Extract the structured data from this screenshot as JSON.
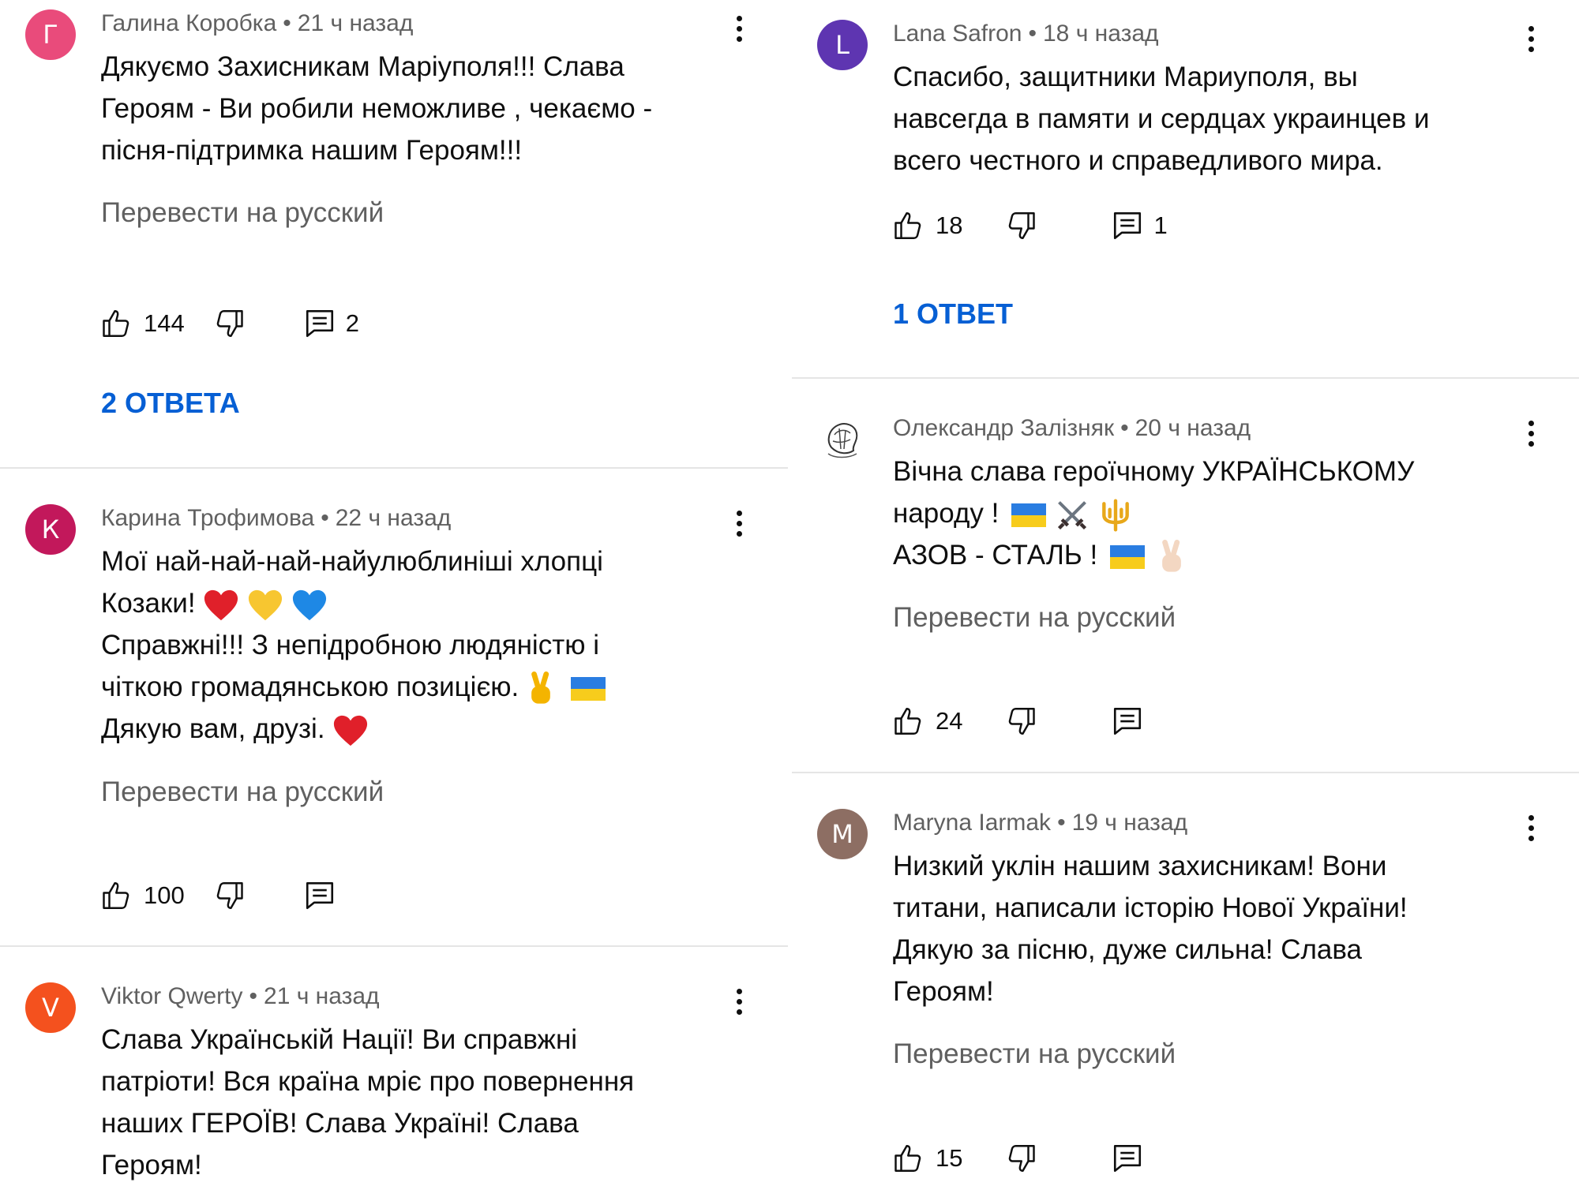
{
  "comments_left": [
    {
      "author": "Галина Коробка",
      "time": "21 ч назад",
      "avatar_letter": "Г",
      "avatar_color": "#e94b7b",
      "lines": [
        "Дякуємо Захисникам Маріуполя!!! Слава",
        "Героям - Ви робили неможливе , чекаємо  -",
        "пісня-підтримка нашим Героям!!!"
      ],
      "translate": "Перевести на русский",
      "likes": "144",
      "reply_count": "2",
      "replies_link": "2 ОТВЕТА"
    },
    {
      "author": "Карина Трофимова",
      "time": "22 ч назад",
      "avatar_letter": "К",
      "avatar_color": "#c2185b",
      "lines": [
        "Мої най-най-най-найулюблиніші хлопці",
        "Козаки!",
        "Справжні!!! З непідробною людяністю і",
        "чіткою громадянською позицією.",
        "Дякую вам, друзі."
      ],
      "translate": "Перевести на русский",
      "likes": "100"
    },
    {
      "author": "Viktor Qwerty",
      "time": "21 ч назад",
      "avatar_letter": "V",
      "avatar_color": "#f4511e",
      "lines": [
        "Слава Українській Нації! Ви справжні",
        "патріоти! Вся країна мріє про повернення",
        "наших ГЕРОЇВ! Слава Україні! Слава",
        "Героям!"
      ]
    }
  ],
  "comments_right": [
    {
      "author": "Lana Safron",
      "time": "18 ч назад",
      "avatar_letter": "L",
      "avatar_color": "#5e35b1",
      "lines": [
        "Спасибо, защитники Мариуполя, вы",
        "навсегда в памяти и сердцах украинцев и",
        "всего честного и справедливого мира."
      ],
      "likes": "18",
      "reply_count": "1",
      "replies_link": "1 ОТВЕТ"
    },
    {
      "author": "Олександр Залізняк",
      "time": "20 ч назад",
      "avatar_icon": "sketch-avatar-icon",
      "lines": [
        "Вічна слава героїчному УКРАЇНСЬКОМУ",
        "народу !",
        "АЗОВ - СТАЛЬ !"
      ],
      "translate": "Перевести на русский",
      "likes": "24"
    },
    {
      "author": "Maryna Iarmak",
      "time": "19 ч назад",
      "avatar_letter": "M",
      "avatar_color": "#8d6e63",
      "lines": [
        "Низкий уклін нашим захисникам! Вони",
        "титани, написали історію Нової України!",
        "Дякую за пісню, дуже сильна! Слава",
        "Героям!"
      ],
      "translate": "Перевести на русский",
      "likes": "15"
    }
  ],
  "separator": "•",
  "icons": [
    "like-icon",
    "dislike-icon",
    "reply-icon",
    "more-vert-icon",
    "ukraine-flag-icon",
    "heart-icon",
    "victory-hand-icon",
    "crossed-swords-icon",
    "trident-icon"
  ]
}
